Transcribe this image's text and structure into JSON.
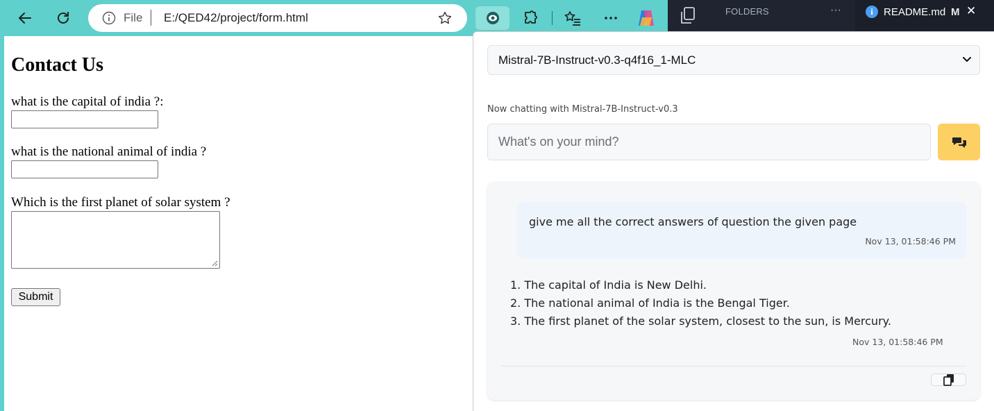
{
  "browser": {
    "address": {
      "scheme_label": "File",
      "url": "E:/QED42/project/form.html"
    },
    "toolbar_icons": [
      "back-arrow-icon",
      "refresh-icon",
      "info-icon",
      "favorite-star-icon",
      "assistant-extension-icon",
      "extensions-puzzle-icon",
      "favorites-list-icon",
      "more-options-icon",
      "copilot-icon"
    ]
  },
  "editor": {
    "folders_label": "FOLDERS",
    "more_label": "···",
    "tab": {
      "name": "README.md",
      "modified_flag": "M",
      "close_label": "✕"
    }
  },
  "form": {
    "title": "Contact Us",
    "questions": [
      {
        "label": "what is the capital of india ?:",
        "value": ""
      },
      {
        "label": "what is the national animal of india ?",
        "value": ""
      },
      {
        "label": "Which is the first planet of solar system ?",
        "value": ""
      }
    ],
    "submit_label": "Submit"
  },
  "assistant": {
    "model_selected": "Mistral-7B-Instruct-v0.3-q4f16_1-MLC",
    "status": "Now chatting with Mistral-7B-Instruct-v0.3",
    "input_placeholder": "What's on your mind?",
    "messages": [
      {
        "role": "user",
        "text": "give me all the correct answers of question the given page",
        "time": "Nov 13, 01:58:46 PM"
      },
      {
        "role": "assistant",
        "items": [
          "1. The capital of India is New Delhi.",
          "2. The national animal of India is the Bengal Tiger.",
          "3. The first planet of the solar system, closest to the sun, is Mercury."
        ],
        "time": "Nov 13, 01:58:46 PM"
      }
    ]
  },
  "colors": {
    "browser_chrome": "#5fd0cc",
    "editor_bg": "#1f2430",
    "send_button": "#fdd064",
    "info_badge": "#4a9df2"
  }
}
